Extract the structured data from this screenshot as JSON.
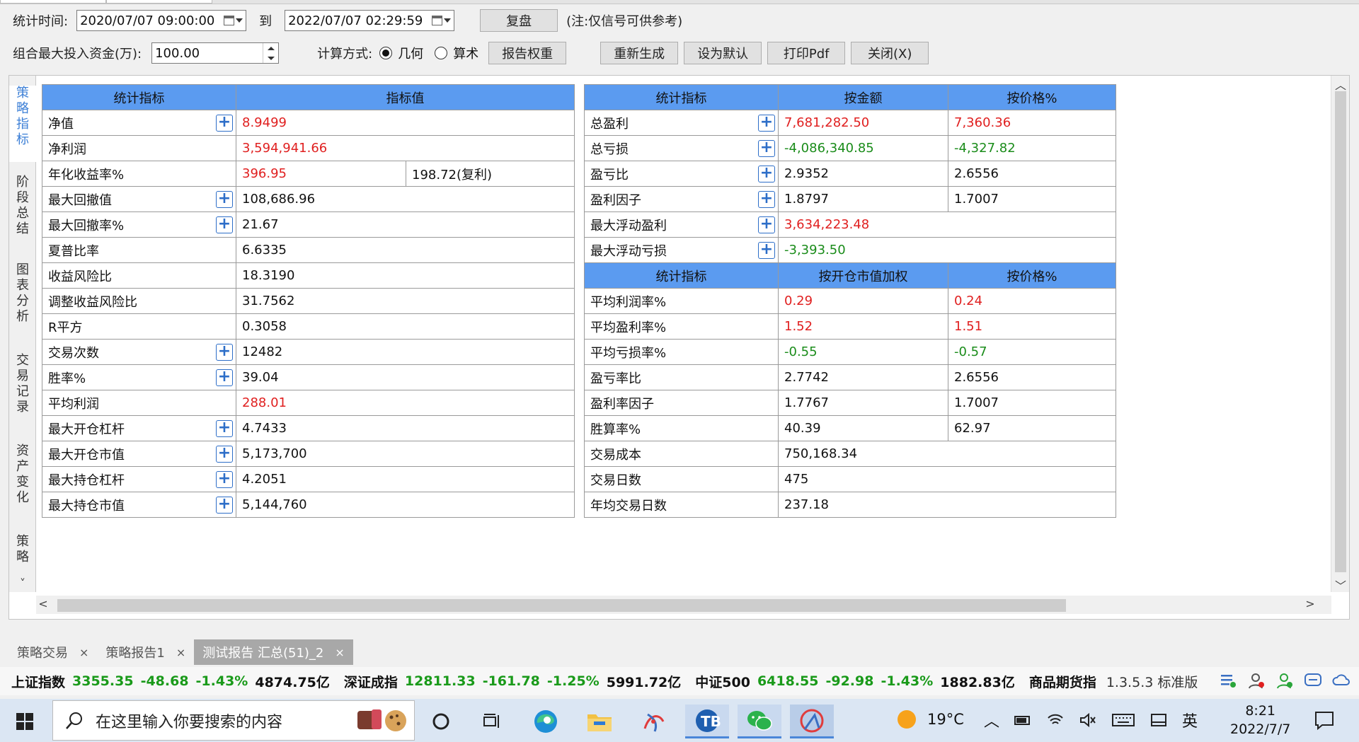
{
  "filters": {
    "stat_time_label": "统计时间:",
    "start_date": "2020/07/07 09:00:00",
    "to_label": "到",
    "end_date": "2022/07/07 02:29:59",
    "replay_label": "复盘",
    "note": "(注:仅信号可供参考)",
    "max_capital_label": "组合最大投入资金(万):",
    "max_capital_value": "100.00",
    "calc_method_label": "计算方式:",
    "calc_geometric": "几何",
    "calc_arithmetic": "算术",
    "report_weight_label": "报告权重",
    "regenerate_label": "重新生成",
    "set_default_label": "设为默认",
    "print_pdf_label": "打印Pdf",
    "close_label": "关闭(X)"
  },
  "side_tabs": [
    "策略指标",
    "阶段总结",
    "图表分析",
    "交易记录",
    "资产变化",
    "策略"
  ],
  "left_table": {
    "headers": [
      "统计指标",
      "指标值"
    ],
    "rows": [
      {
        "name": "净值",
        "value": "8.9499",
        "color": "red",
        "plus": true
      },
      {
        "name": "净利润",
        "value": "3,594,941.66",
        "color": "red",
        "plus": false
      },
      {
        "name": "年化收益率%",
        "value": "396.95",
        "value2": "198.72(复利)",
        "color": "red",
        "plus": false
      },
      {
        "name": "最大回撤值",
        "value": "108,686.96",
        "color": "",
        "plus": true
      },
      {
        "name": "最大回撤率%",
        "value": "21.67",
        "color": "",
        "plus": true
      },
      {
        "name": "夏普比率",
        "value": "6.6335",
        "color": "",
        "plus": false
      },
      {
        "name": "收益风险比",
        "value": "18.3190",
        "color": "",
        "plus": false
      },
      {
        "name": "调整收益风险比",
        "value": "31.7562",
        "color": "",
        "plus": false
      },
      {
        "name": "R平方",
        "value": "0.3058",
        "color": "",
        "plus": false
      },
      {
        "name": "交易次数",
        "value": "12482",
        "color": "",
        "plus": true
      },
      {
        "name": "胜率%",
        "value": "39.04",
        "color": "",
        "plus": true
      },
      {
        "name": "平均利润",
        "value": "288.01",
        "color": "red",
        "plus": false
      },
      {
        "name": "最大开仓杠杆",
        "value": "4.7433",
        "color": "",
        "plus": true
      },
      {
        "name": "最大开仓市值",
        "value": "5,173,700",
        "color": "",
        "plus": true
      },
      {
        "name": "最大持仓杠杆",
        "value": "4.2051",
        "color": "",
        "plus": true
      },
      {
        "name": "最大持仓市值",
        "value": "5,144,760",
        "color": "",
        "plus": true
      }
    ]
  },
  "right_table": {
    "headers": [
      "统计指标",
      "按金额",
      "按价格%"
    ],
    "rows": [
      {
        "name": "总盈利",
        "v1": "7,681,282.50",
        "v2": "7,360.36",
        "color": "red",
        "plus": true
      },
      {
        "name": "总亏损",
        "v1": "-4,086,340.85",
        "v2": "-4,327.82",
        "color": "green",
        "plus": true
      },
      {
        "name": "盈亏比",
        "v1": "2.9352",
        "v2": "2.6556",
        "color": "",
        "plus": true
      },
      {
        "name": "盈利因子",
        "v1": "1.8797",
        "v2": "1.7007",
        "color": "",
        "plus": true
      },
      {
        "name": "最大浮动盈利",
        "v1": "3,634,223.48",
        "v2": null,
        "color": "red",
        "plus": true
      },
      {
        "name": "最大浮动亏损",
        "v1": "-3,393.50",
        "v2": null,
        "color": "green",
        "plus": true
      }
    ],
    "headers2": [
      "统计指标",
      "按开仓市值加权",
      "按价格%"
    ],
    "rows2": [
      {
        "name": "平均利润率%",
        "v1": "0.29",
        "v2": "0.24",
        "color": "red"
      },
      {
        "name": "平均盈利率%",
        "v1": "1.52",
        "v2": "1.51",
        "color": "red"
      },
      {
        "name": "平均亏损率%",
        "v1": "-0.55",
        "v2": "-0.57",
        "color": "green"
      },
      {
        "name": "盈亏率比",
        "v1": "2.7742",
        "v2": "2.6556",
        "color": ""
      },
      {
        "name": "盈利率因子",
        "v1": "1.7767",
        "v2": "1.7007",
        "color": ""
      },
      {
        "name": "胜算率%",
        "v1": "40.39",
        "v2": "62.97",
        "color": ""
      },
      {
        "name": "交易成本",
        "v1": "750,168.34",
        "v2": null,
        "color": ""
      },
      {
        "name": "交易日数",
        "v1": "475",
        "v2": null,
        "color": ""
      },
      {
        "name": "年均交易日数",
        "v1": "237.18",
        "v2": null,
        "color": ""
      }
    ]
  },
  "bottom_tabs": [
    {
      "label": "策略交易",
      "active": false
    },
    {
      "label": "策略报告1",
      "active": false
    },
    {
      "label": "测试报告 汇总(51)_2",
      "active": true
    }
  ],
  "ticker": {
    "sh_name": "上证指数",
    "sh_price": "3355.35",
    "sh_chg": "-48.68",
    "sh_pct": "-1.43%",
    "sh_vol": "4874.75亿",
    "sz_name": "深证成指",
    "sz_price": "12811.33",
    "sz_chg": "-161.78",
    "sz_pct": "-1.25%",
    "sz_vol": "5991.72亿",
    "zz_name": "中证500",
    "zz_price": "6418.55",
    "zz_chg": "-92.98",
    "zz_pct": "-1.43%",
    "zz_vol": "1882.83亿",
    "futures_label": "商品期货指",
    "version": "1.3.5.3 标准版"
  },
  "taskbar": {
    "search_placeholder": "在这里输入你要搜索的内容",
    "weather": "19°C",
    "ime": "英",
    "time": "8:21",
    "date": "2022/7/7"
  },
  "colors": {
    "header_blue": "#5b9bf0",
    "red": "#e02020",
    "green": "#1a8c1a",
    "tab_blue": "#3c7fd6"
  }
}
